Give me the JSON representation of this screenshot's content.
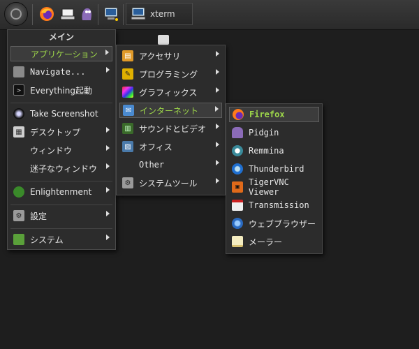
{
  "shelf": {
    "task_label": "xterm"
  },
  "main_menu": {
    "title": "メイン",
    "items": [
      {
        "label": "アプリケーション",
        "icon": "none"
      },
      {
        "label": "Navigate...",
        "icon": "folder-icon"
      },
      {
        "label": "Everything起動",
        "icon": "terminal-icon"
      },
      {
        "label": "Take Screenshot",
        "icon": "camera-icon"
      },
      {
        "label": "デスクトップ",
        "icon": "desktop-icon"
      },
      {
        "label": "ウィンドウ",
        "icon": "none"
      },
      {
        "label": "迷子なウィンドウ",
        "icon": "none"
      },
      {
        "label": "Enlightenment",
        "icon": "enlightenment-icon"
      },
      {
        "label": "設定",
        "icon": "settings-icon"
      },
      {
        "label": "システム",
        "icon": "system-icon"
      }
    ]
  },
  "apps_menu": {
    "items": [
      {
        "label": "アクセサリ"
      },
      {
        "label": "プログラミング"
      },
      {
        "label": "グラフィックス"
      },
      {
        "label": "インターネット"
      },
      {
        "label": "サウンドとビデオ"
      },
      {
        "label": "オフィス"
      },
      {
        "label": "Other"
      },
      {
        "label": "システムツール"
      }
    ]
  },
  "internet_menu": {
    "items": [
      {
        "label": "Firefox"
      },
      {
        "label": "Pidgin"
      },
      {
        "label": "Remmina"
      },
      {
        "label": "Thunderbird"
      },
      {
        "label": "TigerVNC Viewer"
      },
      {
        "label": "Transmission"
      },
      {
        "label": "ウェブブラウザー"
      },
      {
        "label": "メーラー"
      }
    ]
  },
  "colors": {
    "highlight": "#9ed84a",
    "menu_bg": "#2c2c2c",
    "desktop_bg": "#1e1e1e"
  }
}
